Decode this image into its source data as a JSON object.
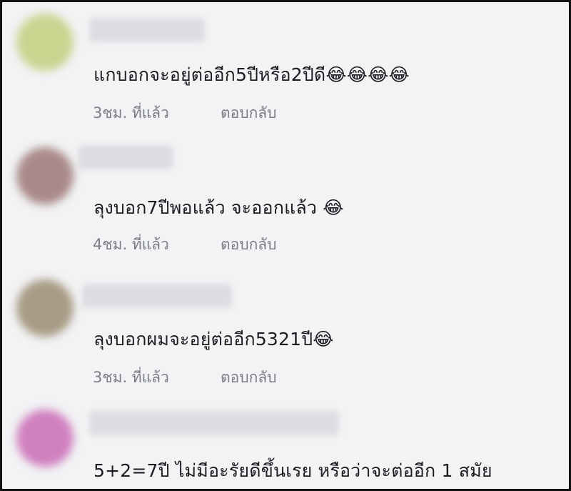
{
  "comments": [
    {
      "text": "แกบอกจะอยู่ต่ออีก5ปีหรือ2ปีดี😂😂😂😂",
      "time": "3ชม. ที่แล้ว",
      "reply": "ตอบกลับ",
      "avatar_color": "#c9d48f"
    },
    {
      "text": "ลุงบอก7ปีพอแล้ว จะออกแล้ว 😂",
      "time": "4ชม. ที่แล้ว",
      "reply": "ตอบกลับ",
      "avatar_color": "#a98a88"
    },
    {
      "text": "ลุงบอกผมจะอยู่ต่ออีก5321ปี😂",
      "time": "3ชม. ที่แล้ว",
      "reply": "ตอบกลับ",
      "avatar_color": "#a89a84"
    },
    {
      "text": "5+2=7ปี ไม่มีอะรัยดีขึ้นเรย หรือว่าจะต่ออีก 1 สมัย",
      "time": "",
      "reply": "",
      "avatar_color": "#d07fbf"
    }
  ]
}
